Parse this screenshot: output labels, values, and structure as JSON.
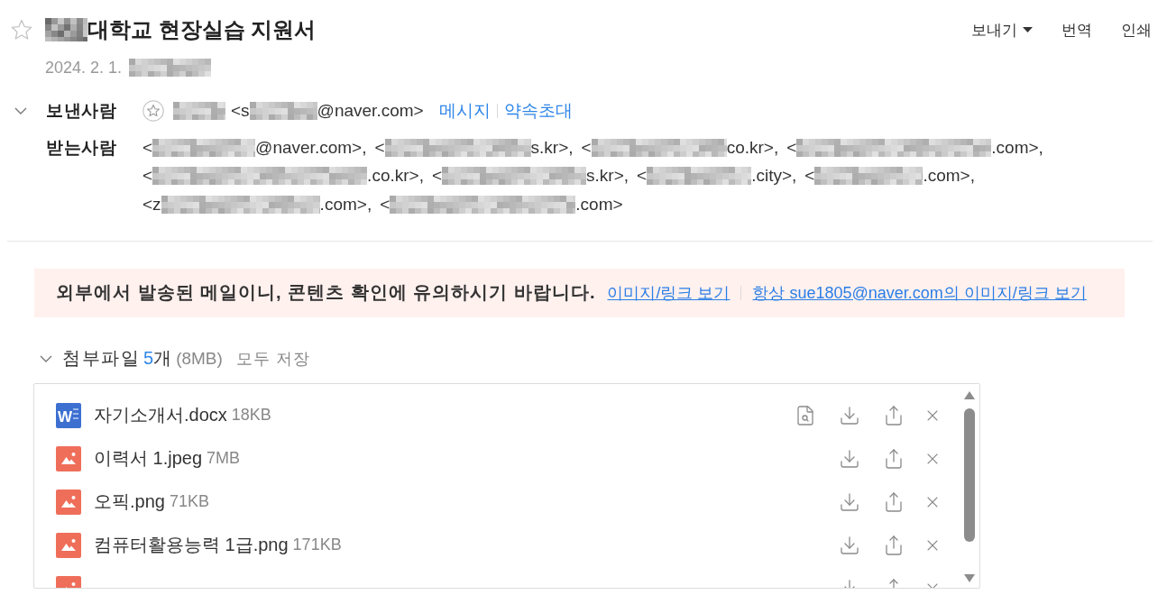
{
  "subject": {
    "starred": false,
    "title": "대학교 현장실습 지원서",
    "date": "2024. 2. 1."
  },
  "toolbar": [
    {
      "label": "보내기",
      "kind": "dropdown"
    },
    {
      "label": "번역",
      "kind": "plain"
    },
    {
      "label": "인쇄",
      "kind": "plain"
    }
  ],
  "header_details": {
    "expanded": true,
    "sender": {
      "label": "보낸사람",
      "starred": false,
      "address_start": "<s",
      "address_end": "@naver.com>",
      "actions": [
        "메시지",
        "약속초대"
      ]
    },
    "recipients": {
      "label": "받는사람",
      "addresses": [
        {
          "start": "<",
          "end": "@naver.com>,"
        },
        {
          "start": "<",
          "end": "s.kr>,"
        },
        {
          "start": "<",
          "end": "co.kr>,"
        },
        {
          "start": "<",
          "end": ".com>,"
        },
        {
          "start": "<",
          "end": ".co.kr>,"
        },
        {
          "start": "<",
          "end": "s.kr>,"
        },
        {
          "start": "<",
          "end": ".city>,"
        },
        {
          "start": "<",
          "end": ".com>,"
        },
        {
          "start": "<z",
          "end": ".com>,"
        },
        {
          "start": "<",
          "end": ".com>"
        }
      ]
    }
  },
  "security_notice": {
    "message": "외부에서 발송된 메일이니, 콘텐츠 확인에 유의하시기 바랍니다.",
    "links": [
      "이미지/링크 보기",
      "항상 sue1805@naver.com의 이미지/링크 보기"
    ]
  },
  "attachments": {
    "expanded": true,
    "label": "첨부파일",
    "count": "5",
    "count_unit": "개",
    "total_size": "(8MB)",
    "save_all": "모두 저장",
    "files": [
      {
        "kind": "word",
        "icon_letter": "W",
        "name": "자기소개서.docx",
        "size": "18KB",
        "previewable": true
      },
      {
        "kind": "image",
        "name": "이력서 1.jpeg",
        "size": "7MB",
        "previewable": false
      },
      {
        "kind": "image",
        "name": "오픽.png",
        "size": "71KB",
        "previewable": false
      },
      {
        "kind": "image",
        "name": "컴퓨터활용능력 1급.png",
        "size": "171KB",
        "previewable": false
      },
      {
        "kind": "image",
        "previewable": false
      }
    ]
  }
}
